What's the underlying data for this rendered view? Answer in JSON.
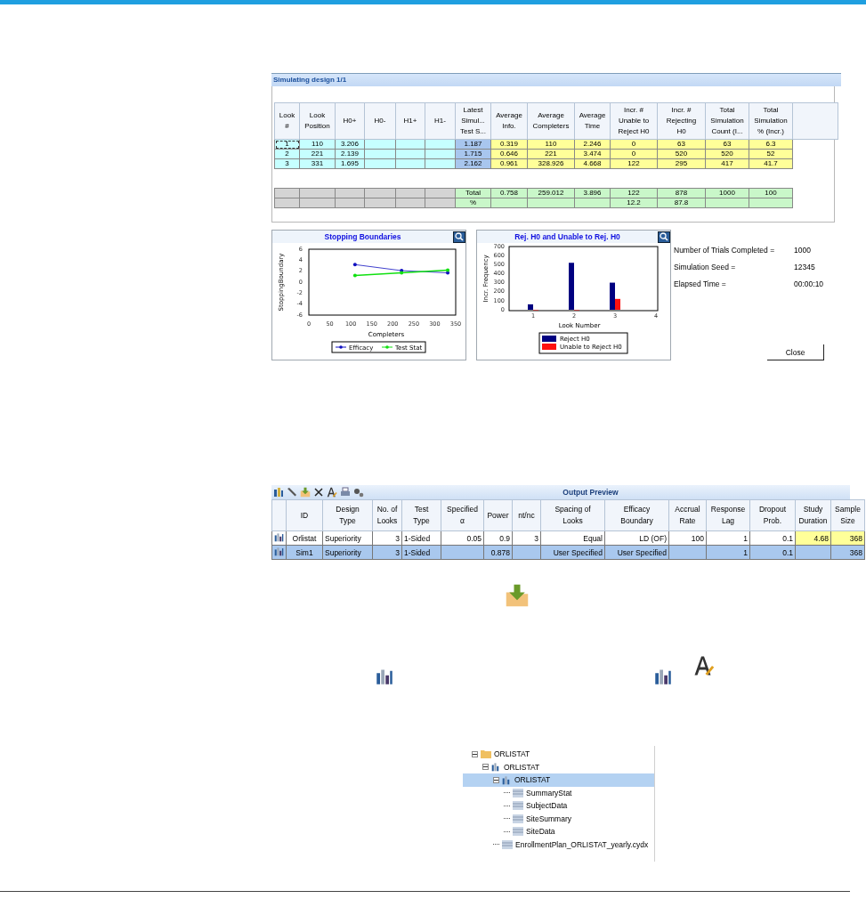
{
  "simulation_window": {
    "title": "Simulating design 1/1",
    "table": {
      "columns": [
        "Look\n#",
        "Look\nPosition",
        "H0+",
        "H0-",
        "H1+",
        "H1-",
        "Latest\nSimul...\nTest S...",
        "Average\nInfo.",
        "Average\nCompleters",
        "Average\nTime",
        "Incr. #\nUnable to\nReject H0",
        "Incr. #\nRejecting\nH0",
        "Total\nSimulation\nCount  (I...",
        "Total\nSimulation\n% (Incr.)"
      ],
      "rows": [
        {
          "selected": true,
          "cells": [
            "1",
            "110",
            "3.206",
            null,
            null,
            null,
            "1.187",
            "0.319",
            "110",
            "2.246",
            "0",
            "63",
            "63",
            "6.3"
          ]
        },
        {
          "selected": false,
          "cells": [
            "2",
            "221",
            "2.139",
            null,
            null,
            null,
            "1.715",
            "0.646",
            "221",
            "3.474",
            "0",
            "520",
            "520",
            "52"
          ]
        },
        {
          "selected": false,
          "cells": [
            "3",
            "331",
            "1.695",
            null,
            null,
            null,
            "2.162",
            "0.961",
            "328.926",
            "4.668",
            "122",
            "295",
            "417",
            "41.7"
          ]
        }
      ],
      "summary_rows": [
        [
          null,
          null,
          null,
          null,
          null,
          null,
          "Total",
          "0.758",
          "259.012",
          "3.896",
          "122",
          "878",
          "1000",
          "100"
        ],
        [
          null,
          null,
          null,
          null,
          null,
          null,
          "%",
          null,
          null,
          null,
          "12.2",
          "87.8",
          null,
          null
        ]
      ]
    },
    "charts": [
      {
        "title": "Stopping Boundaries",
        "chart_data": {
          "type": "line",
          "legend": "bottom",
          "xlabel": "Completers",
          "ylabel": "StoppingBoundary",
          "x": [
            110,
            221,
            331
          ],
          "xlim": [
            0,
            350
          ],
          "ylim": [
            -6,
            6
          ],
          "xticks": [
            0,
            50,
            100,
            150,
            200,
            250,
            300,
            350
          ],
          "yticks": [
            -6,
            -4,
            -2,
            0,
            2,
            4,
            6
          ],
          "series": [
            {
              "name": "Efficacy",
              "color": "#1010c0",
              "values": [
                3.2,
                2.1,
                1.7
              ]
            },
            {
              "name": "Test Stat",
              "color": "#10e010",
              "values": [
                1.2,
                1.7,
                2.2
              ]
            }
          ]
        }
      },
      {
        "title": "Rej. H0 and Unable to Rej. H0",
        "chart_data": {
          "type": "bar",
          "legend": "bottom",
          "xlabel": "Look Number",
          "ylabel": "Incr. Frequency",
          "categories": [
            "1",
            "2",
            "3",
            "4"
          ],
          "ylim": [
            0,
            700
          ],
          "yticks": [
            0,
            100,
            200,
            300,
            400,
            500,
            600,
            700
          ],
          "series": [
            {
              "name": "Reject H0",
              "color": "#000080",
              "values": [
                60,
                520,
                300,
                null
              ]
            },
            {
              "name": "Unable to Reject H0",
              "color": "#ff1010",
              "values": [
                0,
                0,
                120,
                null
              ]
            }
          ]
        }
      }
    ],
    "stats": [
      {
        "label": "Number of Trials Completed =",
        "value": "1000"
      },
      {
        "label": "Simulation Seed =",
        "value": "12345"
      },
      {
        "label": "Elapsed Time =",
        "value": "00:00:10"
      }
    ],
    "close_button": "Close"
  },
  "output_preview": {
    "title": "Output Preview",
    "columns": [
      "ID",
      "Design\nType",
      "No. of\nLooks",
      "Test\nType",
      "Specified\nα",
      "Power",
      "nt/nc",
      "Spacing of\nLooks",
      "Efficacy\nBoundary",
      "Accrual\nRate",
      "Response\nLag",
      "Dropout\nProb.",
      "Study\nDuration",
      "Sample\nSize"
    ],
    "rows": [
      {
        "selected": false,
        "cells": [
          "Orlistat",
          "Superiority",
          "3",
          "1-Sided",
          "0.05",
          "0.9",
          "3",
          "Equal",
          "LD (OF)",
          "100",
          "1",
          "0.1",
          "4.68",
          "368"
        ]
      },
      {
        "selected": true,
        "cells": [
          "Sim1",
          "Superiority",
          "3",
          "1-Sided",
          null,
          "0.878",
          null,
          "User Specified",
          "User Specified",
          null,
          "1",
          "0.1",
          null,
          "368"
        ]
      }
    ]
  },
  "tree": [
    {
      "label": "ORLISTAT",
      "kind": "folder",
      "expanded": true,
      "selected": false,
      "children": [
        {
          "label": "ORLISTAT",
          "kind": "design",
          "expanded": true,
          "selected": false,
          "children": [
            {
              "label": "ORLISTAT",
              "kind": "design",
              "expanded": true,
              "selected": true,
              "children": [
                {
                  "label": "SummaryStat",
                  "kind": "table",
                  "selected": false
                },
                {
                  "label": "SubjectData",
                  "kind": "table",
                  "selected": false
                },
                {
                  "label": "SiteSummary",
                  "kind": "table",
                  "selected": false
                },
                {
                  "label": "SiteData",
                  "kind": "table",
                  "selected": false
                }
              ]
            },
            {
              "label": "EnrollmentPlan_ORLISTAT_yearly.cydx",
              "kind": "table",
              "selected": false
            }
          ]
        }
      ]
    }
  ]
}
